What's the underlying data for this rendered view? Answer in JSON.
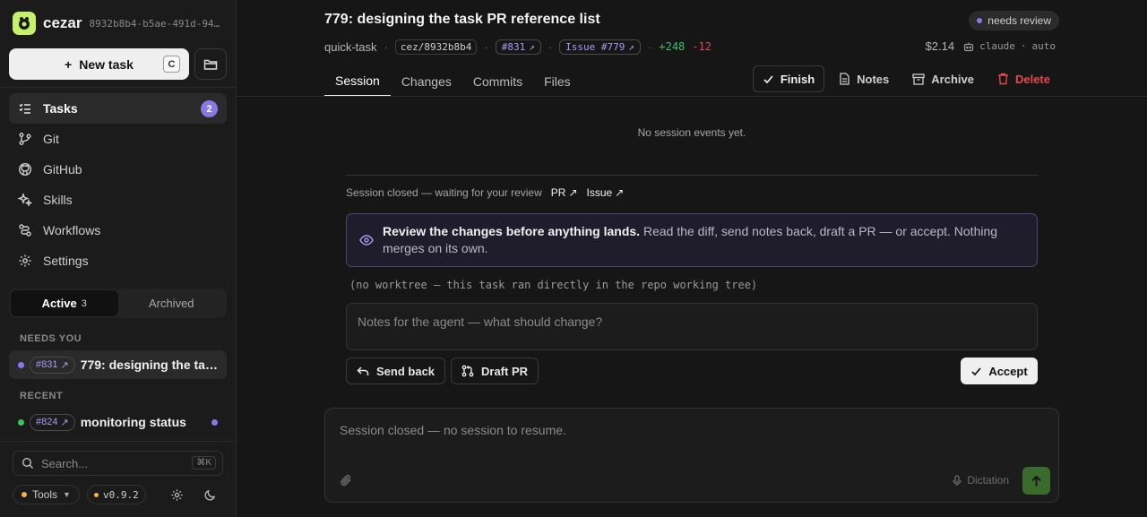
{
  "sidebar": {
    "brand": {
      "name": "cezar",
      "id": "8932b8b4-b5ae-491d-94…"
    },
    "new_task": {
      "label": "New task",
      "shortcut": "C"
    },
    "nav": [
      {
        "label": "Tasks",
        "icon": "list-check-icon",
        "badge": "2"
      },
      {
        "label": "Git",
        "icon": "git-branch-icon"
      },
      {
        "label": "GitHub",
        "icon": "github-icon"
      },
      {
        "label": "Skills",
        "icon": "sparkle-icon"
      },
      {
        "label": "Workflows",
        "icon": "workflow-icon"
      },
      {
        "label": "Settings",
        "icon": "gear-icon"
      }
    ],
    "tabs": {
      "active": "Active",
      "active_count": "3",
      "archived": "Archived"
    },
    "sections": {
      "needs_you": "NEEDS YOU",
      "recent": "RECENT"
    },
    "tasks": [
      {
        "ref": "#831",
        "name": "779: designing the ta…",
        "dot_color": "#8a78e6"
      },
      {
        "ref": "#824",
        "name": "monitoring status",
        "dot_color": "#3fbf67",
        "unread_color": "#8a78e6"
      }
    ],
    "search": {
      "placeholder": "Search...",
      "shortcut": "⌘K"
    },
    "tools_label": "Tools",
    "version": "v0.9.2"
  },
  "header": {
    "title": "779: designing the task PR reference list",
    "status": "needs review",
    "meta": {
      "kind": "quick-task",
      "branch": "cez/8932b8b4",
      "pr": "#831",
      "issue": "Issue #779",
      "additions": "+248",
      "deletions": "-12",
      "cost": "$2.14",
      "agent": "claude",
      "mode": "auto"
    },
    "tabs": [
      "Session",
      "Changes",
      "Commits",
      "Files"
    ],
    "actions": {
      "finish": "Finish",
      "notes": "Notes",
      "archive": "Archive",
      "delete": "Delete"
    }
  },
  "session": {
    "empty": "No session events yet.",
    "closed_text": "Session closed — waiting for your review",
    "pr_link": "PR",
    "issue_link": "Issue",
    "callout_bold": "Review the changes before anything lands.",
    "callout_text": "Read the diff, send notes back, draft a PR — or accept. Nothing merges on its own.",
    "no_worktree": "(no worktree — this task ran directly in the repo working tree)",
    "notes_placeholder": "Notes for the agent — what should change?",
    "send_back": "Send back",
    "draft_pr": "Draft PR",
    "accept": "Accept"
  },
  "composer": {
    "placeholder": "Session closed — no session to resume.",
    "dictation": "Dictation"
  }
}
